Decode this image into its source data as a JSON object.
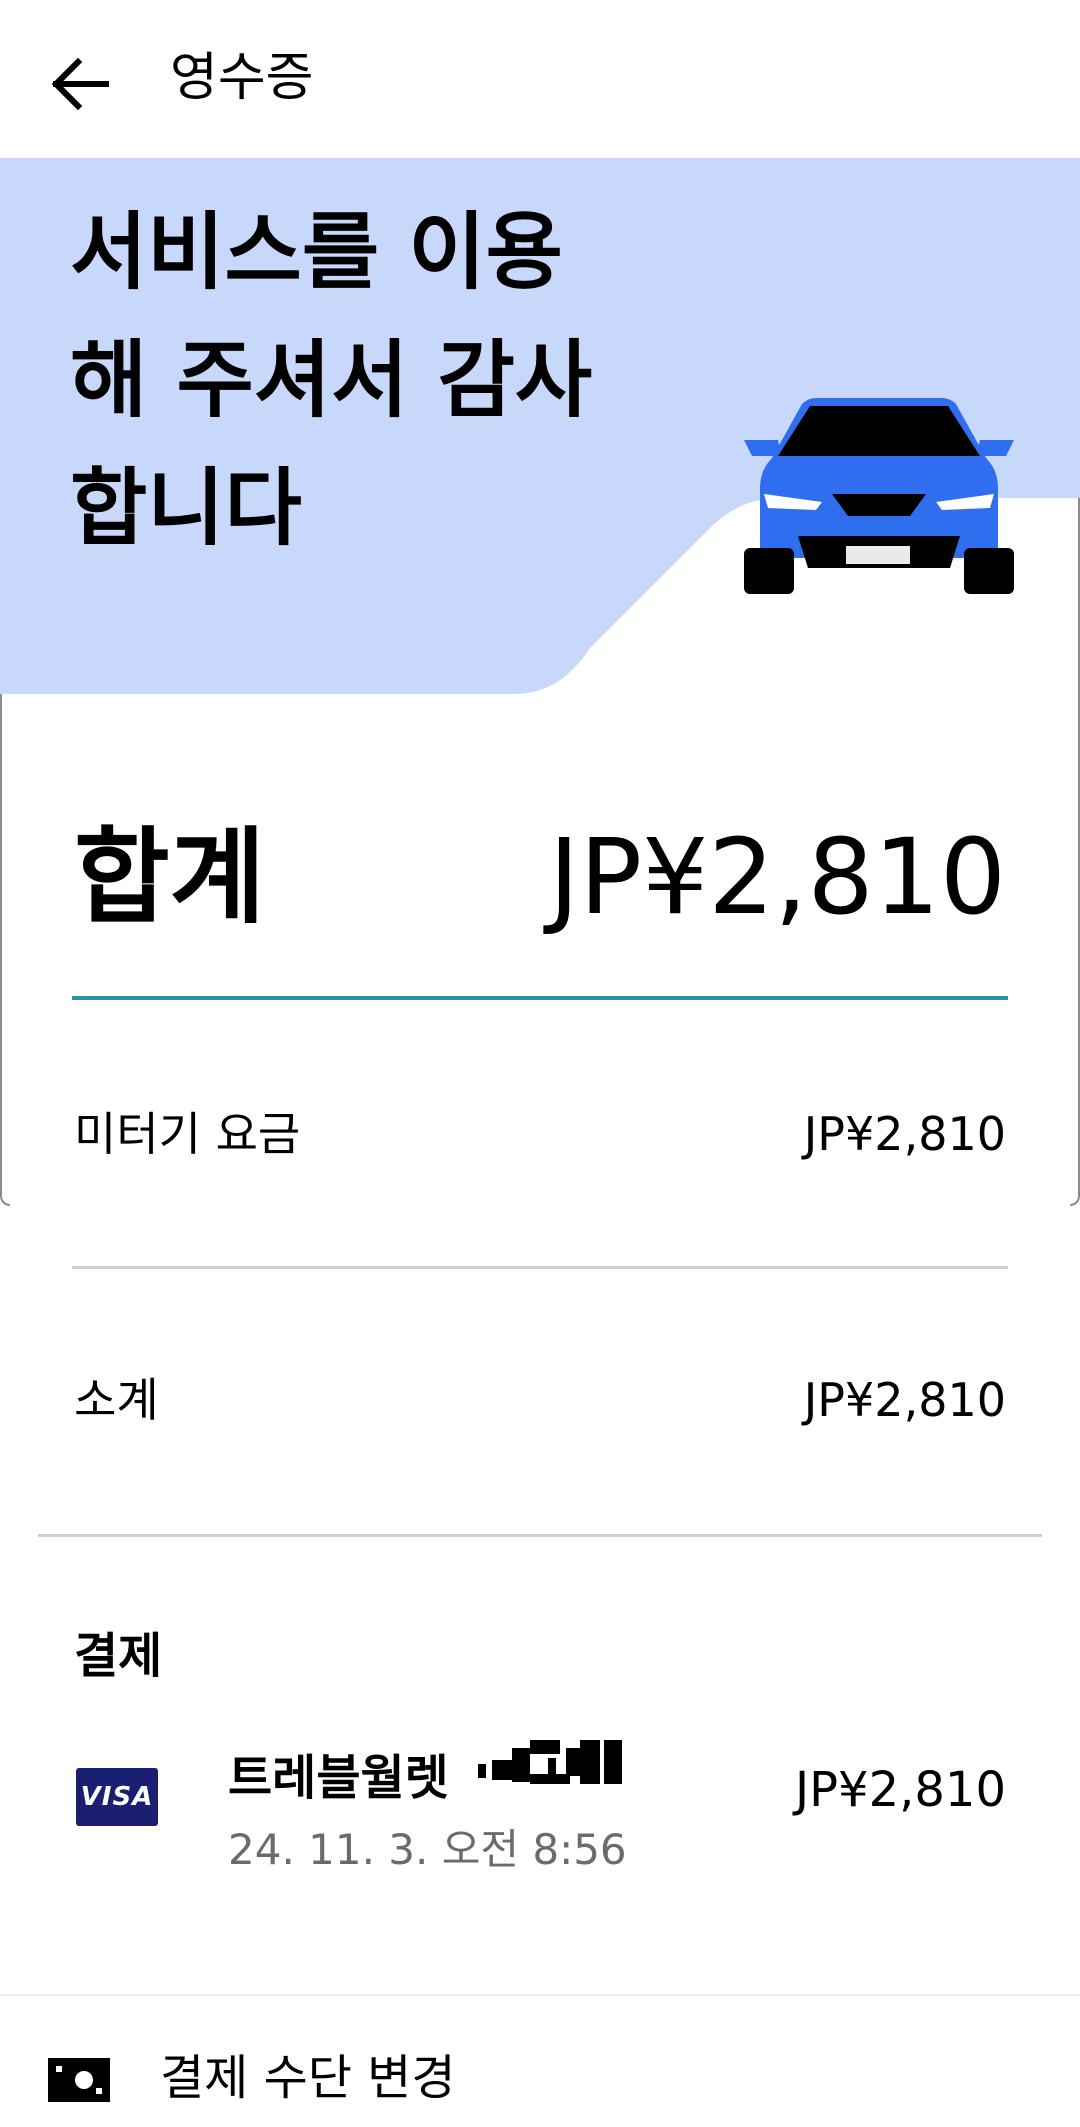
{
  "header": {
    "title": "영수증"
  },
  "hero": {
    "title_lines": [
      "서비스를 이용",
      "해 주셔서 감사",
      "합니다"
    ]
  },
  "summary": {
    "total_label": "합계",
    "total_value": "JP¥2,810",
    "meter_label": "미터기 요금",
    "meter_value": "JP¥2,810",
    "subtotal_label": "소계",
    "subtotal_value": "JP¥2,810"
  },
  "payment": {
    "section_label": "결제",
    "card_brand": "VISA",
    "card_name": "트레블월렛",
    "date": "24. 11. 3. 오전 8:56",
    "amount": "JP¥2,810"
  },
  "actions": {
    "change_method_label": "결제 수단 변경"
  },
  "colors": {
    "hero_bg": "#c7d8fa",
    "car_blue": "#2f6fef",
    "total_rule": "#2b8fa8",
    "visa_blue": "#1a1f71"
  }
}
